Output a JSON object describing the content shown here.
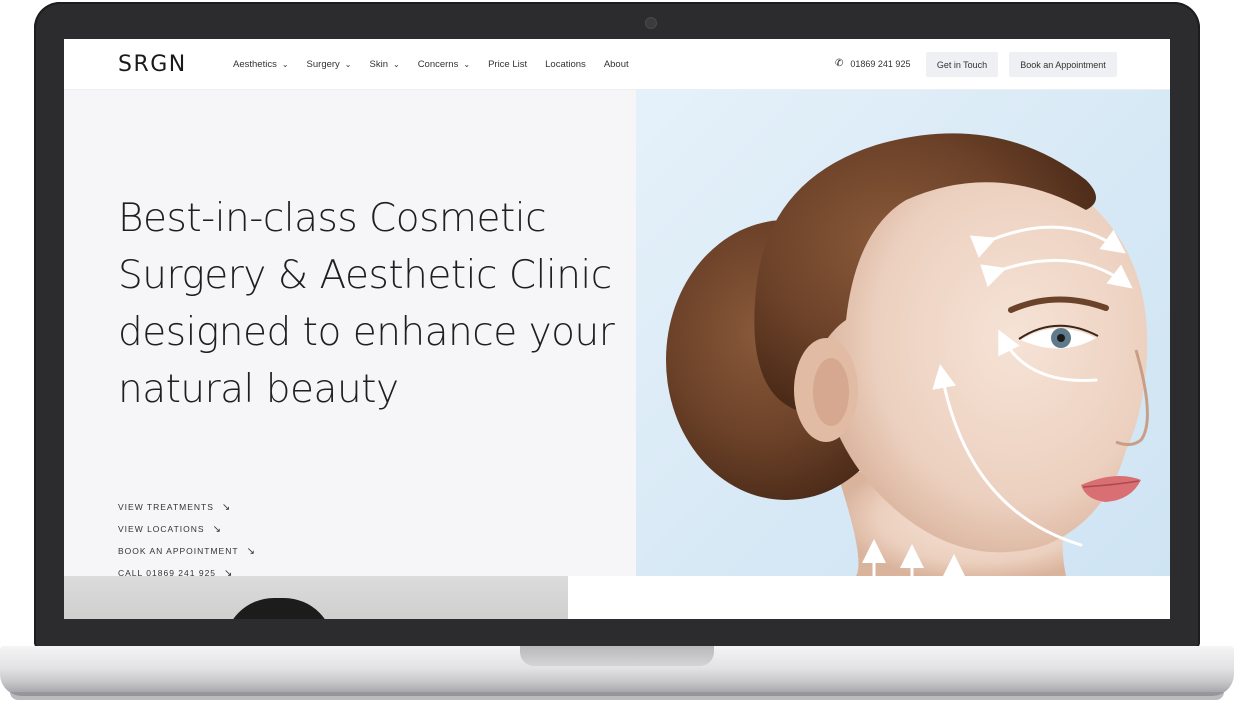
{
  "brand": {
    "logo": "SRGN"
  },
  "nav": {
    "items": [
      {
        "label": "Aesthetics",
        "dropdown": true
      },
      {
        "label": "Surgery",
        "dropdown": true
      },
      {
        "label": "Skin",
        "dropdown": true
      },
      {
        "label": "Concerns",
        "dropdown": true
      },
      {
        "label": "Price List",
        "dropdown": false
      },
      {
        "label": "Locations",
        "dropdown": false
      },
      {
        "label": "About",
        "dropdown": false
      }
    ],
    "phone": "01869 241 925",
    "get_in_touch": "Get in Touch",
    "book": "Book an Appointment"
  },
  "hero": {
    "headline": "Best-in-class Cosmetic Surgery & Aesthetic Clinic designed to enhance your natural beauty",
    "links": [
      "VIEW TREATMENTS",
      "VIEW LOCATIONS",
      "BOOK AN APPOINTMENT",
      "CALL 01869 241 925"
    ]
  },
  "icons": {
    "phone": "phone-icon",
    "dropdown": "chevron-down-icon",
    "link_arrow": "arrow-down-right-icon",
    "camera": "camera-icon"
  },
  "colors": {
    "hero_left_bg": "#f6f6f8",
    "hero_right_bg": "#d6e8f5",
    "button_bg": "#eef0f4",
    "text": "#1f1f1f"
  }
}
